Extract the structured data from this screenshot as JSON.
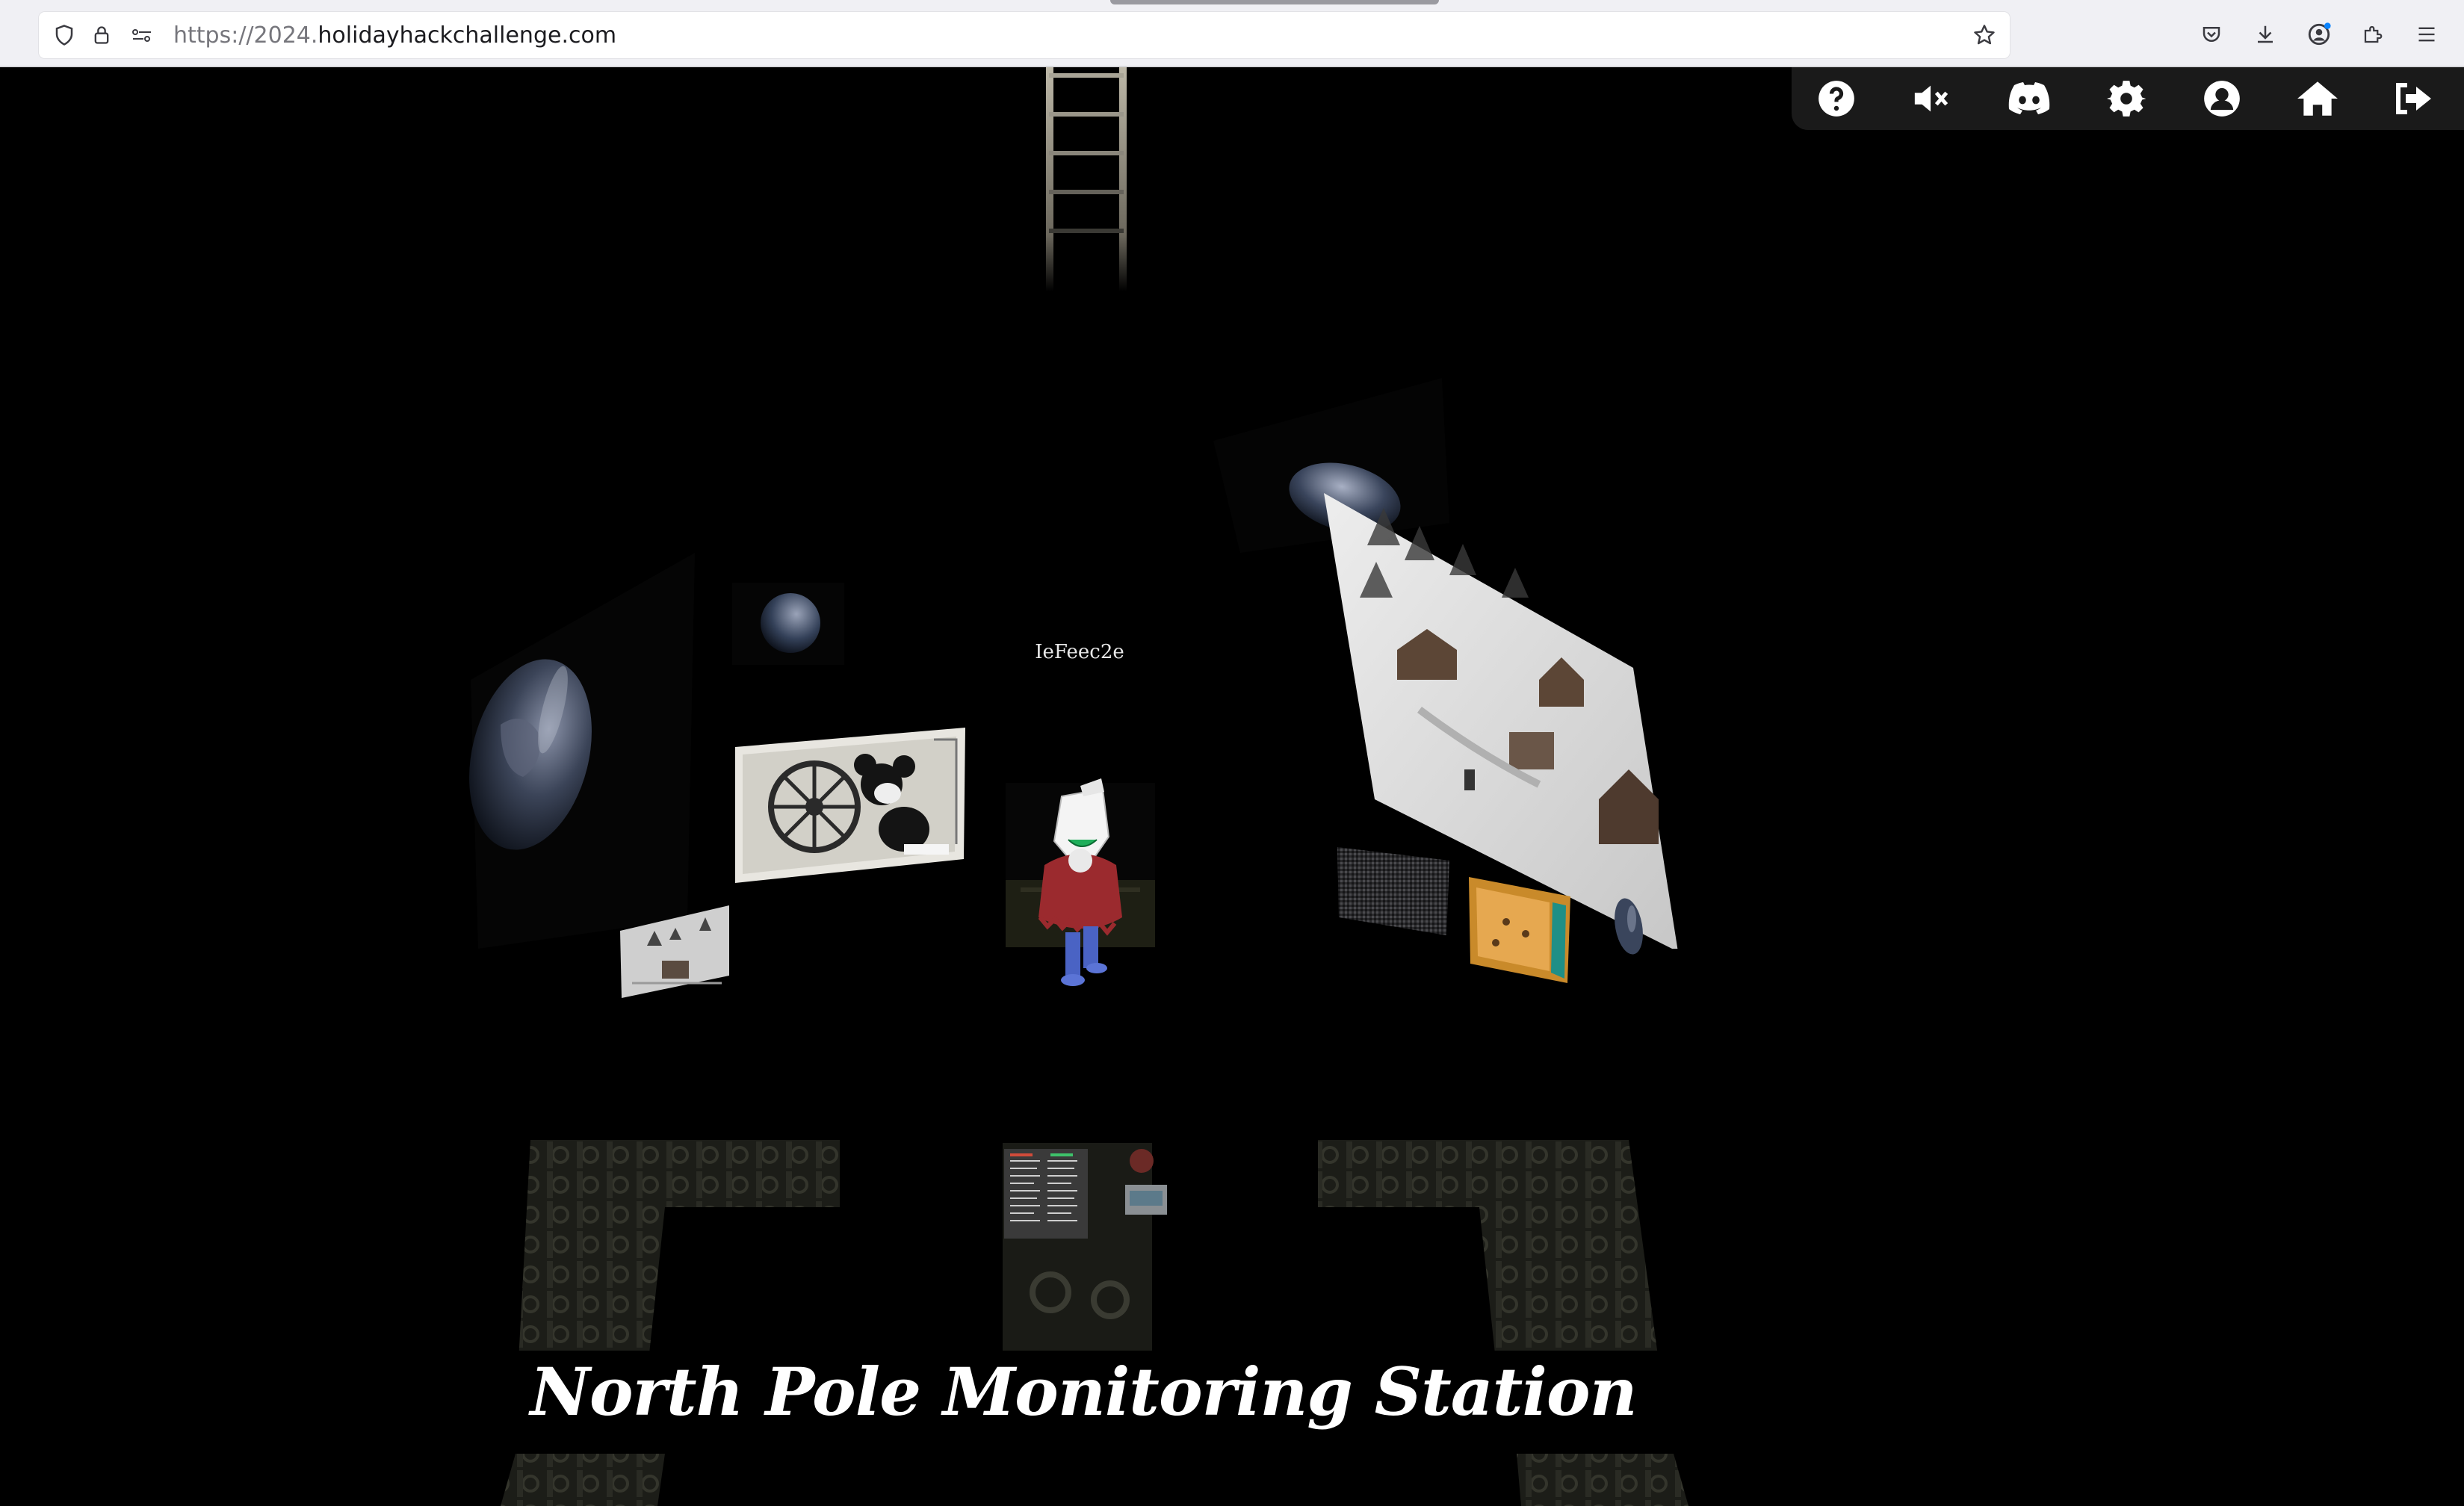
{
  "browser": {
    "url_scheme": "https://2024.",
    "url_host": "holidayhackchallenge.com",
    "icons": [
      "shield-icon",
      "lock-icon",
      "permissions-icon",
      "bookmark-star-icon",
      "pocket-icon",
      "download-icon",
      "account-icon",
      "extensions-icon",
      "menu-icon"
    ]
  },
  "toolbar": {
    "buttons": [
      "help-icon",
      "mute-icon",
      "discord-icon",
      "settings-gear-icon",
      "profile-icon",
      "home-icon",
      "logout-icon"
    ]
  },
  "scene": {
    "player_name": "IeFeec2e",
    "title": "North Pole Monitoring Station"
  },
  "colors": {
    "background": "#000000",
    "toolbar": "#1a1a1a",
    "chrome": "#f0f0f4"
  }
}
